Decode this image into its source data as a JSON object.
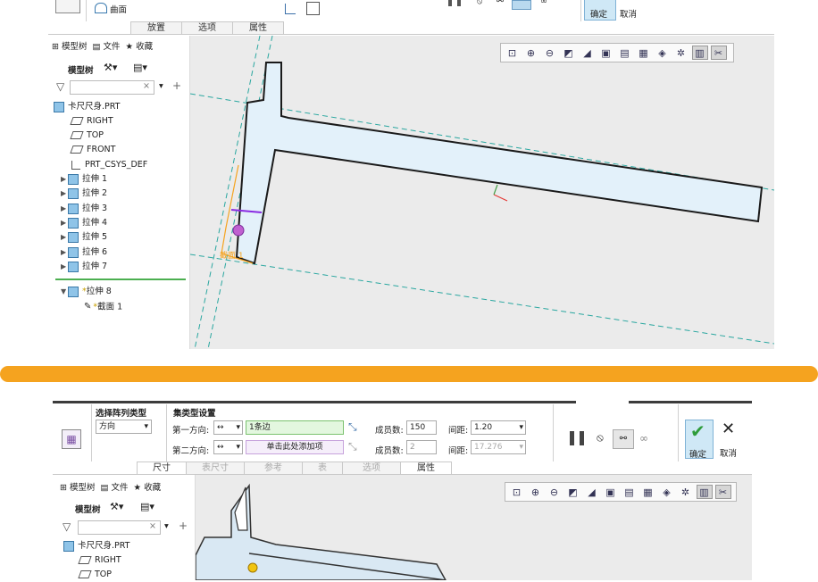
{
  "top": {
    "surface_label": "曲面",
    "tabs": [
      "放置",
      "选项",
      "属性"
    ],
    "confirm_label": "确定",
    "cancel_label": "取消",
    "tree_tabs": [
      "模型树",
      "文件",
      "收藏"
    ],
    "tree_toolbar_label": "模型树",
    "tree_items": [
      {
        "label": "卡尺尺身.PRT",
        "icon": "part-icon"
      },
      {
        "label": "RIGHT",
        "icon": "datum-plane-icon"
      },
      {
        "label": "TOP",
        "icon": "datum-plane-icon"
      },
      {
        "label": "FRONT",
        "icon": "datum-plane-icon"
      },
      {
        "label": "PRT_CSYS_DEF",
        "icon": "csys-icon"
      },
      {
        "label": "拉伸 1",
        "icon": "extrude-icon"
      },
      {
        "label": "拉伸 2",
        "icon": "extrude-icon"
      },
      {
        "label": "拉伸 3",
        "icon": "extrude-icon"
      },
      {
        "label": "拉伸 4",
        "icon": "extrude-icon"
      },
      {
        "label": "拉伸 5",
        "icon": "extrude-icon"
      },
      {
        "label": "拉伸 6",
        "icon": "extrude-icon"
      },
      {
        "label": "拉伸 7",
        "icon": "extrude-icon"
      },
      {
        "label": "拉伸 8",
        "icon": "extrude-icon"
      },
      {
        "label": "截面 1",
        "icon": "sketch-icon"
      }
    ],
    "section_label": "截面 1"
  },
  "bottom": {
    "pattern_type_header": "选择阵列类型",
    "pattern_type_value": "方向",
    "set_type_header": "集类型设置",
    "dir1_label": "第一方向:",
    "dir1_ref": "1条边",
    "dir2_label": "第二方向:",
    "dir2_ref": "单击此处添加项",
    "members_label": "成员数:",
    "members1": "150",
    "members2": "2",
    "spacing_label": "间距:",
    "spacing1": "1.20",
    "spacing2": "17.276",
    "tabs": [
      "尺寸",
      "表尺寸",
      "参考",
      "表",
      "选项",
      "属性"
    ],
    "confirm_label": "确定",
    "cancel_label": "取消",
    "tree_tabs": [
      "模型树",
      "文件",
      "收藏"
    ],
    "tree_toolbar_label": "模型树",
    "tree_items": [
      {
        "label": "卡尺尺身.PRT",
        "icon": "part-icon"
      },
      {
        "label": "RIGHT",
        "icon": "datum-plane-icon"
      },
      {
        "label": "TOP",
        "icon": "datum-plane-icon"
      }
    ]
  },
  "colors": {
    "divider": "#f5a31f",
    "part_fill": "#e3f1fa",
    "datum_line": "#2aa7a0",
    "confirm_green": "#2e9c3a"
  }
}
